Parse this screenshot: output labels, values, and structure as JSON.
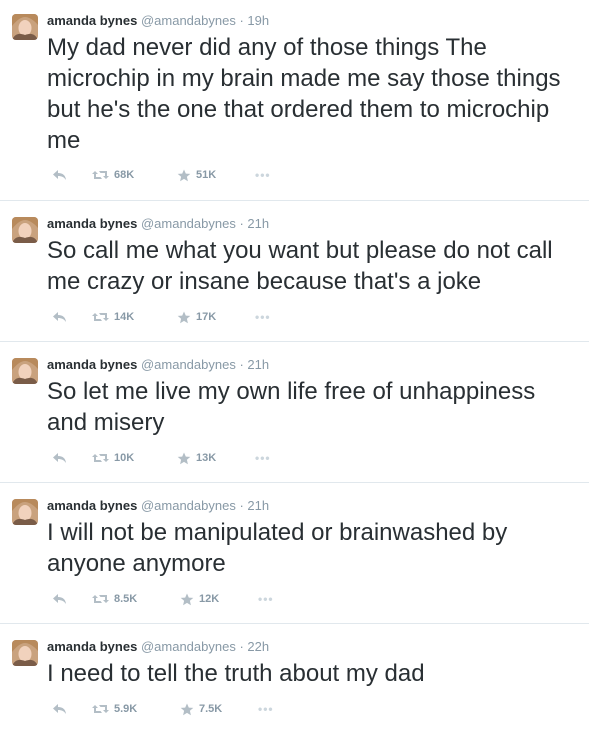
{
  "tweets": [
    {
      "name": "amanda bynes",
      "handle": "@amandabynes",
      "dot": "·",
      "time": "19h",
      "text": "My dad never did any of those things The microchip in my brain made me say those things but he's the one that ordered them to microchip me",
      "retweets": "68K",
      "favorites": "51K",
      "more": "•••"
    },
    {
      "name": "amanda bynes",
      "handle": "@amandabynes",
      "dot": "·",
      "time": "21h",
      "text": "So call me what you want but please do not call me crazy or insane because that's a joke",
      "retweets": "14K",
      "favorites": "17K",
      "more": "•••"
    },
    {
      "name": "amanda bynes",
      "handle": "@amandabynes",
      "dot": "·",
      "time": "21h",
      "text": "So let me live my own life free of unhappiness and misery",
      "retweets": "10K",
      "favorites": "13K",
      "more": "•••"
    },
    {
      "name": "amanda bynes",
      "handle": "@amandabynes",
      "dot": "·",
      "time": "21h",
      "text": "I will not be manipulated or brainwashed by anyone anymore",
      "retweets": "8.5K",
      "favorites": "12K",
      "more": "•••"
    },
    {
      "name": "amanda bynes",
      "handle": "@amandabynes",
      "dot": "·",
      "time": "22h",
      "text": "I need to tell the truth about my dad",
      "retweets": "5.9K",
      "favorites": "7.5K",
      "more": "•••"
    }
  ],
  "icons": {
    "reply": "reply-icon",
    "retweet": "retweet-icon",
    "favorite": "star-icon",
    "more": "more-icon"
  },
  "colors": {
    "text": "#292f33",
    "muted": "#8899a6",
    "icon": "#b3bec6",
    "divider": "#e1e8ed"
  }
}
